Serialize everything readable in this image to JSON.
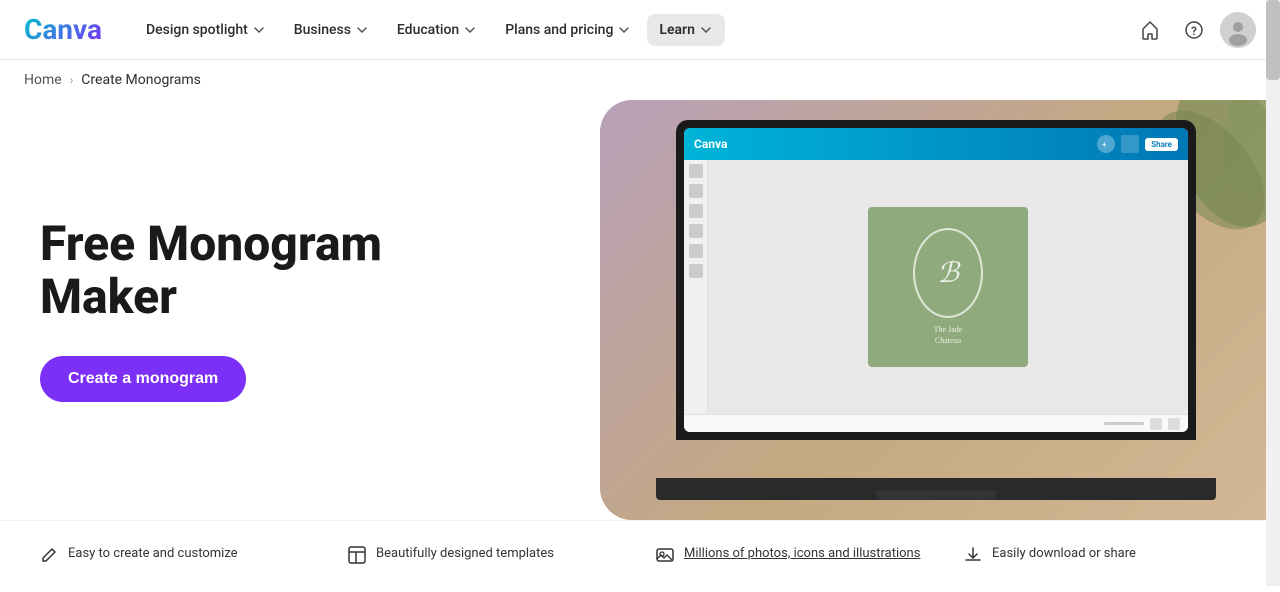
{
  "logo": {
    "text": "Canva"
  },
  "nav": {
    "items": [
      {
        "label": "Design spotlight",
        "hasDropdown": true,
        "active": false
      },
      {
        "label": "Business",
        "hasDropdown": true,
        "active": false
      },
      {
        "label": "Education",
        "hasDropdown": true,
        "active": false
      },
      {
        "label": "Plans and pricing",
        "hasDropdown": true,
        "active": false
      },
      {
        "label": "Learn",
        "hasDropdown": true,
        "active": true
      }
    ]
  },
  "breadcrumb": {
    "home_label": "Home",
    "separator": "›",
    "current": "Create Monograms"
  },
  "hero": {
    "title": "Free Monogram Maker",
    "cta_label": "Create a monogram"
  },
  "editor": {
    "logo": "Canva",
    "monogram_letter": "ℬ",
    "monogram_subtitle": "The Jade\nChateau"
  },
  "features": [
    {
      "icon": "✏️",
      "text": "Easy to create and customize"
    },
    {
      "icon": "▦",
      "text": "Beautifully designed templates"
    },
    {
      "icon": "🖼",
      "text": "Millions of photos, icons and illustrations",
      "hasLink": true
    },
    {
      "icon": "⬇",
      "text": "Easily download or share"
    }
  ],
  "colors": {
    "cta_bg": "#7B2FF7",
    "editor_bar": "#00b4d8",
    "monogram_bg": "#8faa7c"
  }
}
